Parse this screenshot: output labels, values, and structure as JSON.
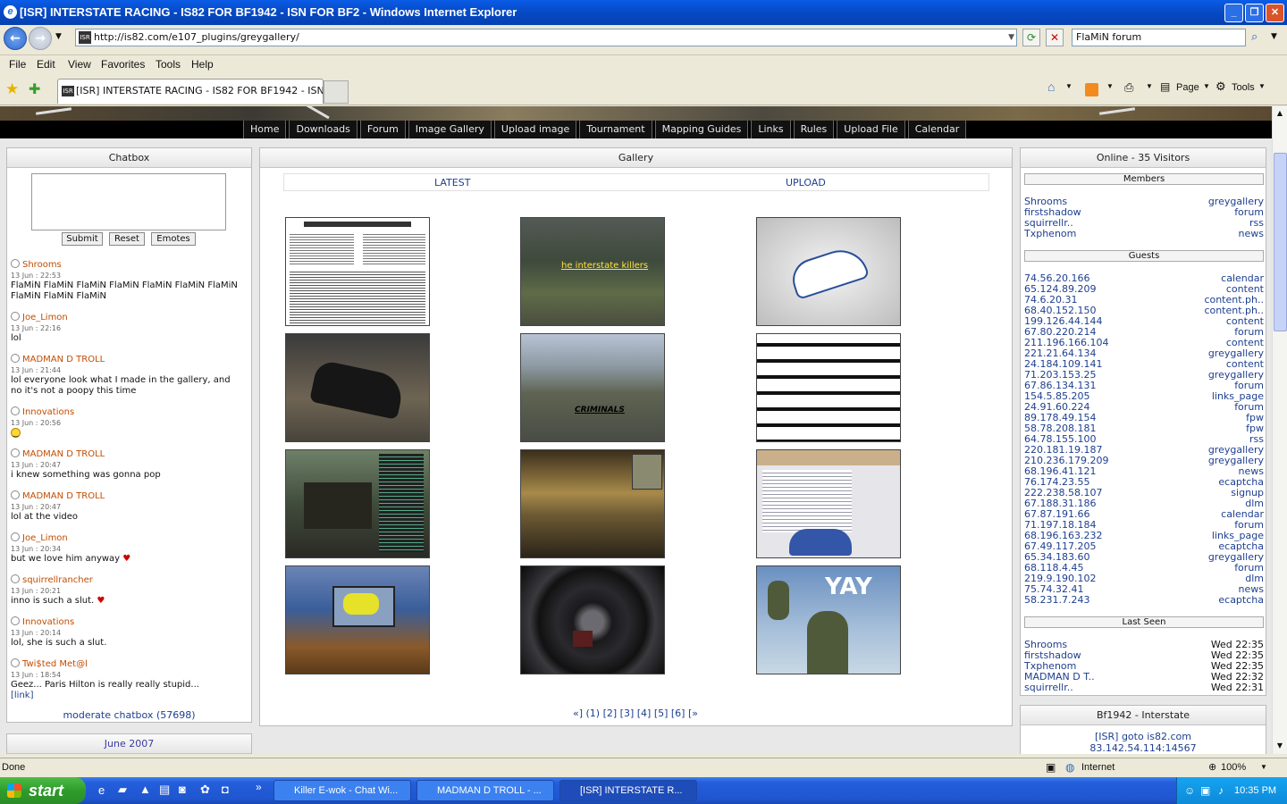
{
  "window": {
    "title": "[ISR] INTERSTATE RACING - IS82 FOR BF1942 - ISN FOR BF2 - Windows Internet Explorer"
  },
  "address": {
    "url": "http://is82.com/e107_plugins/greygallery/",
    "search_value": "FlaMiN forum"
  },
  "menu": [
    "File",
    "Edit",
    "View",
    "Favorites",
    "Tools",
    "Help"
  ],
  "tab": {
    "title": "[ISR] INTERSTATE RACING - IS82 FOR BF1942 - ISN ..."
  },
  "toolbar": {
    "page": "Page",
    "tools": "Tools"
  },
  "nav": [
    "Home",
    "Downloads",
    "Forum",
    "Image Gallery",
    "Upload image",
    "Tournament",
    "Mapping Guides",
    "Links",
    "Rules",
    "Upload File",
    "Calendar"
  ],
  "chatbox": {
    "title": "Chatbox",
    "submit": "Submit",
    "reset": "Reset",
    "emotes": "Emotes",
    "messages": [
      {
        "user": "Shrooms",
        "time": "13 Jun : 22:53",
        "text": "FlaMiN FlaMiN FlaMiN FlaMiN FlaMiN FlaMiN FlaMiN FlaMiN FlaMiN FlaMiN"
      },
      {
        "user": "Joe_Limon",
        "time": "13 Jun : 22:16",
        "text": "lol"
      },
      {
        "user": "MADMAN D TROLL",
        "time": "13 Jun : 21:44",
        "text": "lol everyone look what I made in the gallery, and no it's not a poopy this time"
      },
      {
        "user": "Innovations",
        "time": "13 Jun : 20:56",
        "text": ""
      },
      {
        "user": "MADMAN D TROLL",
        "time": "13 Jun : 20:47",
        "text": "i knew something was gonna pop"
      },
      {
        "user": "MADMAN D TROLL",
        "time": "13 Jun : 20:47",
        "text": "lol at the video"
      },
      {
        "user": "Joe_Limon",
        "time": "13 Jun : 20:34",
        "text": "but we love him anyway"
      },
      {
        "user": "squirrellrancher",
        "time": "13 Jun : 20:21",
        "text": "inno is such a slut."
      },
      {
        "user": "Innovations",
        "time": "13 Jun : 20:14",
        "text": "lol, she is such a slut."
      },
      {
        "user": "Twi$ted Met@l",
        "time": "13 Jun : 18:54",
        "text": "Geez... Paris Hilton is really really stupid..."
      }
    ],
    "link_text": "[link]",
    "moderate": "moderate chatbox (57698)",
    "next_panel": "June 2007"
  },
  "gallery": {
    "title": "Gallery",
    "tab_latest": "LATEST",
    "tab_upload": "UPLOAD",
    "thumb_caption": "he interstate killers",
    "thumb_caption2": "CRIMINALS",
    "thumb_caption3": "YAY",
    "pager": "«] (1) [2] [3] [4] [5] [6] [»"
  },
  "online": {
    "title": "Online - 35 Visitors",
    "members_title": "Members",
    "members": [
      [
        "Shrooms",
        "greygallery"
      ],
      [
        "firstshadow",
        "forum"
      ],
      [
        "squirrellr..",
        "rss"
      ],
      [
        "Txphenom",
        "news"
      ]
    ],
    "guests_title": "Guests",
    "guests": [
      [
        "74.56.20.166",
        "calendar"
      ],
      [
        "65.124.89.209",
        "content"
      ],
      [
        "74.6.20.31",
        "content.ph.."
      ],
      [
        "68.40.152.150",
        "content.ph.."
      ],
      [
        "199.126.44.144",
        "content"
      ],
      [
        "67.80.220.214",
        "forum"
      ],
      [
        "211.196.166.104",
        "content"
      ],
      [
        "221.21.64.134",
        "greygallery"
      ],
      [
        "24.184.109.141",
        "content"
      ],
      [
        "71.203.153.25",
        "greygallery"
      ],
      [
        "67.86.134.131",
        "forum"
      ],
      [
        "154.5.85.205",
        "links_page"
      ],
      [
        "24.91.60.224",
        "forum"
      ],
      [
        "89.178.49.154",
        "fpw"
      ],
      [
        "58.78.208.181",
        "fpw"
      ],
      [
        "64.78.155.100",
        "rss"
      ],
      [
        "220.181.19.187",
        "greygallery"
      ],
      [
        "210.236.179.209",
        "greygallery"
      ],
      [
        "68.196.41.121",
        "news"
      ],
      [
        "76.174.23.55",
        "ecaptcha"
      ],
      [
        "222.238.58.107",
        "signup"
      ],
      [
        "67.188.31.186",
        "dlm"
      ],
      [
        "67.87.191.66",
        "calendar"
      ],
      [
        "71.197.18.184",
        "forum"
      ],
      [
        "68.196.163.232",
        "links_page"
      ],
      [
        "67.49.117.205",
        "ecaptcha"
      ],
      [
        "65.34.183.60",
        "greygallery"
      ],
      [
        "68.118.4.45",
        "forum"
      ],
      [
        "219.9.190.102",
        "dlm"
      ],
      [
        "75.74.32.41",
        "news"
      ],
      [
        "58.231.7.243",
        "ecaptcha"
      ]
    ],
    "lastseen_title": "Last Seen",
    "lastseen": [
      [
        "Shrooms",
        "Wed 22:35"
      ],
      [
        "firstshadow",
        "Wed 22:35"
      ],
      [
        "Txphenom",
        "Wed 22:35"
      ],
      [
        "MADMAN D T..",
        "Wed 22:32"
      ],
      [
        "squirrellr..",
        "Wed 22:31"
      ]
    ]
  },
  "server": {
    "title": "Bf1942 - Interstate",
    "line1": "[ISR] goto is82.com",
    "line2": "83.142.54.114:14567"
  },
  "status": {
    "text": "Done",
    "zone": "Internet",
    "zoom": "100%"
  },
  "taskbar": {
    "start": "start",
    "tasks": [
      "Killer E-wok - Chat Wi...",
      "MADMAN D TROLL - ...",
      "[ISR] INTERSTATE R..."
    ],
    "clock": "10:35 PM"
  }
}
